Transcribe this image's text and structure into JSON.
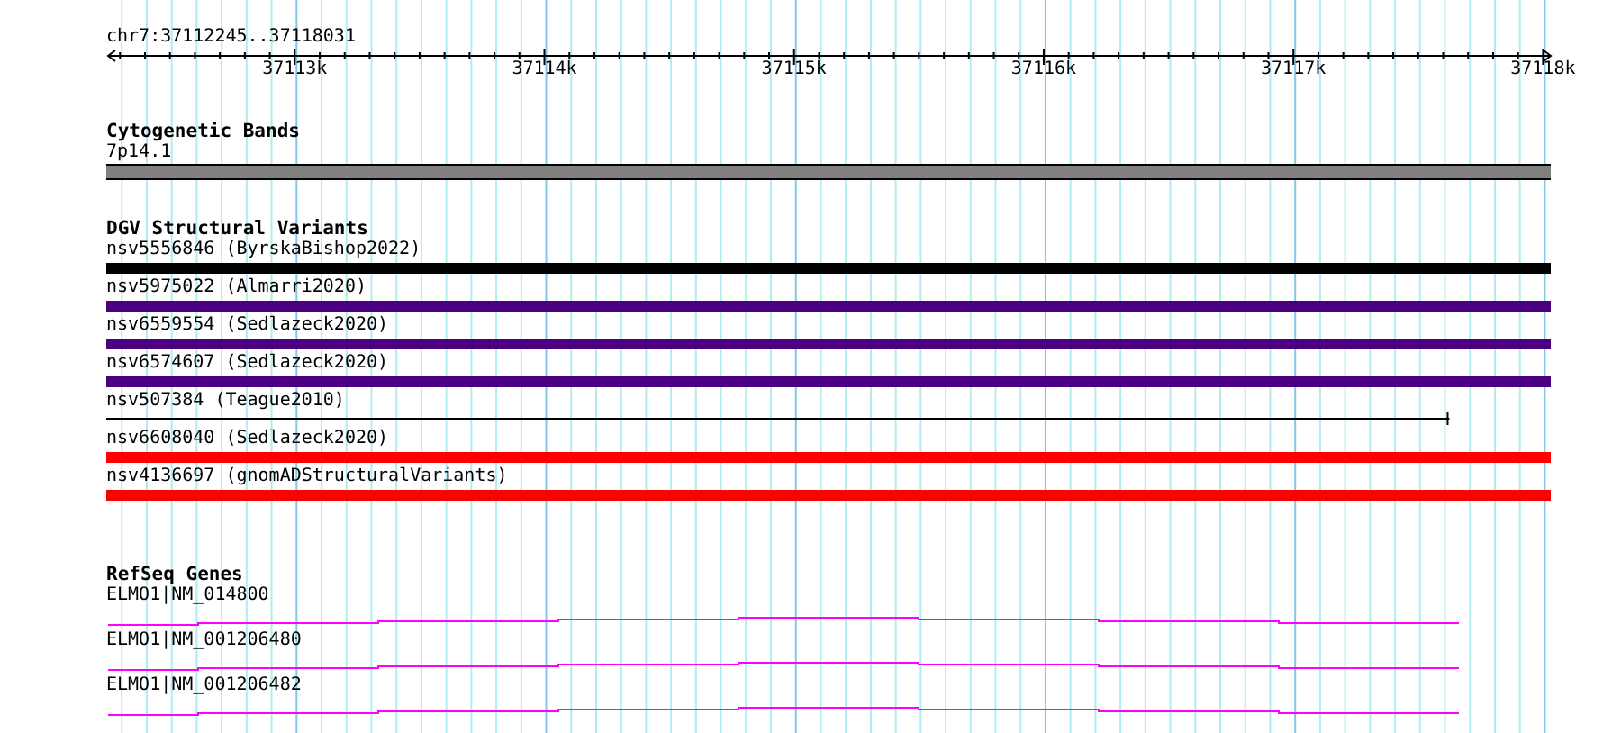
{
  "ruler": {
    "label": "chr7:37112245..37118031",
    "ticks": [
      "37113k",
      "37114k",
      "37115k",
      "37116k",
      "37117k",
      "37118k"
    ]
  },
  "tracks": [
    {
      "kind": "band",
      "title": "Cytogenetic Bands",
      "features": [
        {
          "label": "7p14.1",
          "kind": "band",
          "color": "#808080"
        }
      ]
    },
    {
      "kind": "variants",
      "title": "DGV Structural Variants",
      "features": [
        {
          "label": "nsv5556846 (ByrskaBishop2022)",
          "kind": "bar",
          "color": "#000000"
        },
        {
          "label": "nsv5975022 (Almarri2020)",
          "kind": "bar",
          "color": "#4b0082"
        },
        {
          "label": "nsv6559554 (Sedlazeck2020)",
          "kind": "bar",
          "color": "#4b0082"
        },
        {
          "label": "nsv6574607 (Sedlazeck2020)",
          "kind": "bar",
          "color": "#4b0082"
        },
        {
          "label": "nsv507384 (Teague2010)",
          "kind": "line",
          "color": "#000000"
        },
        {
          "label": "nsv6608040 (Sedlazeck2020)",
          "kind": "bar",
          "color": "#ff0000"
        },
        {
          "label": "nsv4136697 (gnomADStructuralVariants)",
          "kind": "bar",
          "color": "#ff0000"
        }
      ]
    },
    {
      "kind": "genes",
      "title": "RefSeq Genes",
      "features": [
        {
          "label": "ELMO1|NM_014800",
          "kind": "gene",
          "color": "#ff00ff"
        },
        {
          "label": "ELMO1|NM_001206480",
          "kind": "gene",
          "color": "#ff00ff"
        },
        {
          "label": "ELMO1|NM_001206482",
          "kind": "gene",
          "color": "#ff00ff"
        }
      ]
    }
  ]
}
